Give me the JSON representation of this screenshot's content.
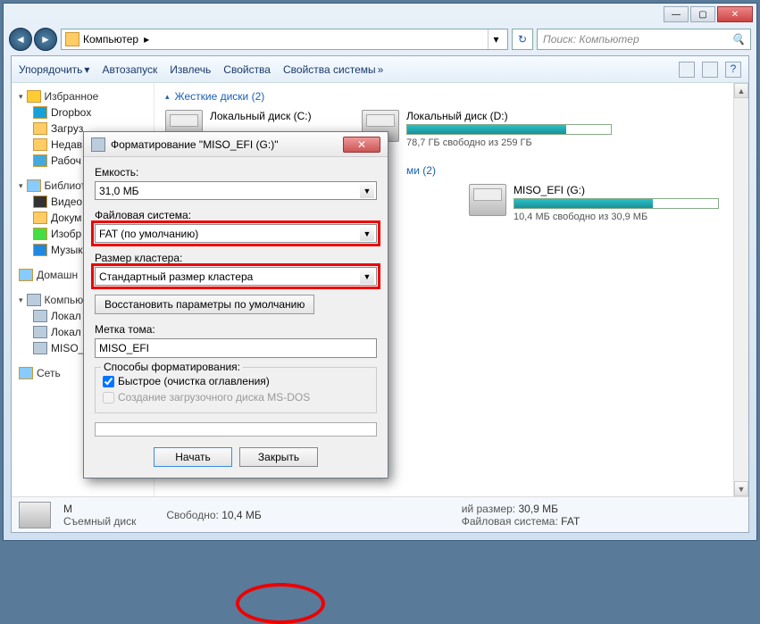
{
  "titlebar": {
    "min": "—",
    "max": "▢",
    "close": "✕"
  },
  "addressbar": {
    "crumb1": "Компьютер",
    "crumb_arrow": "▸",
    "search_placeholder": "Поиск: Компьютер"
  },
  "toolbar": {
    "organize": "Упорядочить",
    "autorun": "Автозапуск",
    "extract": "Извлечь",
    "properties": "Свойства",
    "sys_properties": "Свойства системы"
  },
  "sidebar": {
    "favorites": "Избранное",
    "fav_items": {
      "dropbox": "Dropbox",
      "downloads": "Загруз",
      "recent": "Недав",
      "desktop": "Рабоч"
    },
    "libraries": "Библиот",
    "lib_items": {
      "video": "Видео",
      "docs": "Докум",
      "images": "Изобр",
      "music": "Музык"
    },
    "homegroup": "Домашн",
    "computer": "Компью",
    "comp_items": {
      "local1": "Локал",
      "local2": "Локал",
      "miso": "MISO_"
    },
    "network": "Сеть"
  },
  "main": {
    "hdd_header": "Жесткие диски (2)",
    "removable_header": "ми (2)",
    "drives": {
      "c": {
        "name": "Локальный диск (C:)",
        "sub": ""
      },
      "d": {
        "name": "Локальный диск (D:)",
        "sub": "78,7 ГБ свободно из 259 ГБ",
        "fill": "78%"
      },
      "g": {
        "name": "MISO_EFI (G:)",
        "sub": "10,4 МБ свободно из 30,9 МБ",
        "fill": "68%"
      }
    }
  },
  "statusbar": {
    "name_trunc": "M",
    "type": "Съемный диск",
    "free_label": "Свободно:",
    "free_val": "10,4 МБ",
    "size_label": "ий размер:",
    "size_val": "30,9 МБ",
    "fs_label": "Файловая система:",
    "fs_val": "FAT"
  },
  "dialog": {
    "title": "Форматирование \"MISO_EFI (G:)\"",
    "capacity_label": "Емкость:",
    "capacity_val": "31,0 МБ",
    "fs_label": "Файловая система:",
    "fs_val": "FAT (по умолчанию)",
    "cluster_label": "Размер кластера:",
    "cluster_val": "Стандартный размер кластера",
    "restore_btn": "Восстановить параметры по умолчанию",
    "label_label": "Метка тома:",
    "label_val": "MISO_EFI",
    "methods_group": "Способы форматирования:",
    "quick_chk": "Быстрое (очистка оглавления)",
    "msdos_chk": "Создание загрузочного диска MS-DOS",
    "start_btn": "Начать",
    "close_btn": "Закрыть"
  }
}
